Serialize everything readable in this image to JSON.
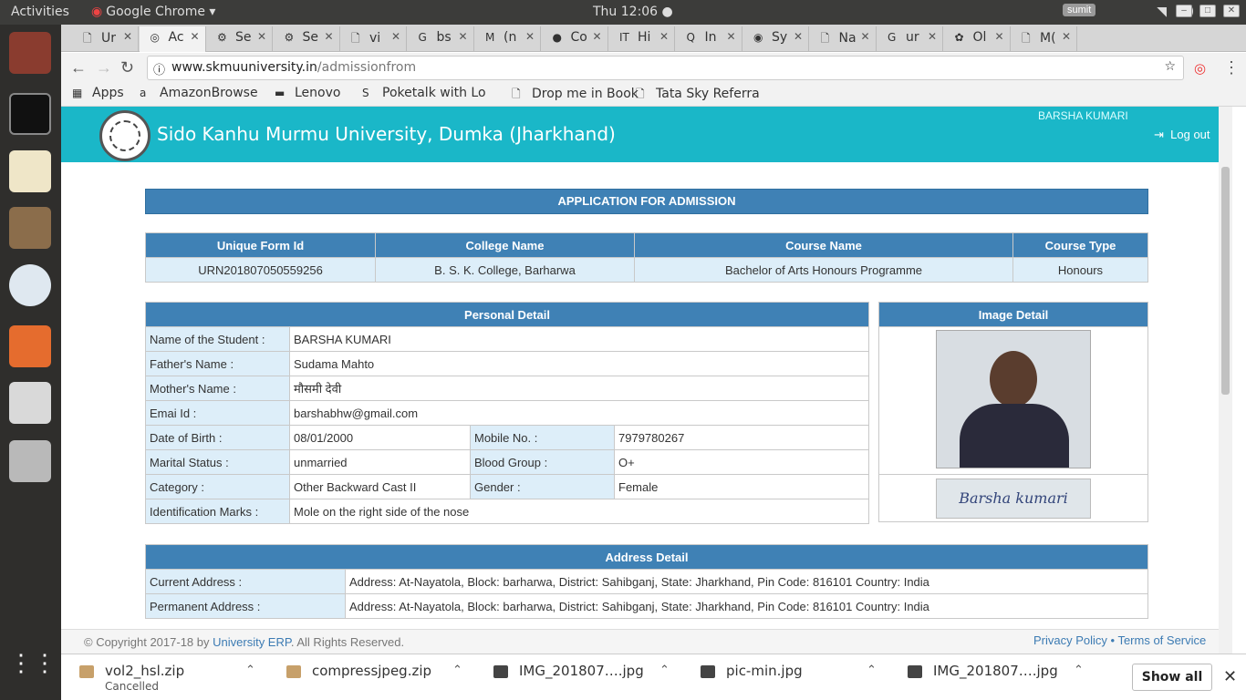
{
  "os": {
    "activities": "Activities",
    "app_menu": "Google Chrome ▾",
    "clock": "Thu 12:06 ●"
  },
  "tabs": [
    {
      "icon": "🗋",
      "label": "Ur"
    },
    {
      "icon": "◎",
      "label": "Ac",
      "active": true
    },
    {
      "icon": "⚙",
      "label": "Se"
    },
    {
      "icon": "⚙",
      "label": "Se"
    },
    {
      "icon": "🗋",
      "label": "vi"
    },
    {
      "icon": "G",
      "label": "bs"
    },
    {
      "icon": "M",
      "label": "(n"
    },
    {
      "icon": "●",
      "label": "Co"
    },
    {
      "icon": "IT",
      "label": "Hi"
    },
    {
      "icon": "Q",
      "label": "In"
    },
    {
      "icon": "◉",
      "label": "Sy"
    },
    {
      "icon": "🗋",
      "label": "Na"
    },
    {
      "icon": "G",
      "label": "ur"
    },
    {
      "icon": "✿",
      "label": "Ol"
    },
    {
      "icon": "🗋",
      "label": "M("
    }
  ],
  "tab_user": "sumit",
  "address": {
    "host": "www.skmuuniversity.in",
    "path": "/admissionfrom"
  },
  "bookmarks": [
    {
      "icon": "▦",
      "label": "Apps"
    },
    {
      "icon": "a",
      "label": "AmazonBrowse"
    },
    {
      "icon": "▬",
      "label": "Lenovo"
    },
    {
      "icon": "S",
      "label": "Poketalk with Lo"
    },
    {
      "icon": "🗋",
      "label": "Drop me in Book"
    },
    {
      "icon": "🗋",
      "label": "Tata Sky Referra"
    }
  ],
  "header": {
    "university": "Sido Kanhu Murmu University, Dumka (Jharkhand)",
    "user": "BARSHA KUMARI",
    "logout": "Log out"
  },
  "form": {
    "title": "APPLICATION FOR ADMISSION",
    "summary_headers": [
      "Unique Form Id",
      "College Name",
      "Course Name",
      "Course Type"
    ],
    "summary_values": [
      "URN201807050559256",
      "B. S. K. College, Barharwa",
      "Bachelor of Arts Honours Programme",
      "Honours"
    ],
    "personal_title": "Personal Detail",
    "image_title": "Image Detail",
    "signature_text": "Barsha kumari",
    "personal": {
      "name_l": "Name of the Student :",
      "name_v": "BARSHA KUMARI",
      "father_l": "Father's Name :",
      "father_v": "Sudama Mahto",
      "mother_l": "Mother's Name :",
      "mother_v": "मौसमी देवी",
      "email_l": "Emai Id :",
      "email_v": "barshabhw@gmail.com",
      "dob_l": "Date of Birth :",
      "dob_v": "08/01/2000",
      "mobile_l": "Mobile No. :",
      "mobile_v": "7979780267",
      "marital_l": "Marital Status :",
      "marital_v": "unmarried",
      "blood_l": "Blood Group :",
      "blood_v": "O+",
      "category_l": "Category :",
      "category_v": "Other Backward Cast II",
      "gender_l": "Gender :",
      "gender_v": "Female",
      "marks_l": "Identification Marks :",
      "marks_v": "Mole on the right side of the nose"
    },
    "address_title": "Address Detail",
    "current_l": "Current Address :",
    "current_v": "Address: At-Nayatola, Block: barharwa, District: Sahibganj, State: Jharkhand, Pin Code: 816101 Country: India",
    "permanent_l": "Permanent Address :",
    "permanent_v": "Address: At-Nayatola, Block: barharwa, District: Sahibganj, State: Jharkhand, Pin Code: 816101 Country: India"
  },
  "footer": {
    "copyright": "© Copyright 2017-18 by",
    "erp": "University ERP",
    "rights": ". All Rights Reserved.",
    "links": "Privacy Policy • Terms of Service"
  },
  "downloads": [
    {
      "name": "vol2_hsl.zip",
      "status": "Cancelled",
      "type": "zip"
    },
    {
      "name": "compressjpeg.zip",
      "status": "",
      "type": "zip"
    },
    {
      "name": "IMG_201807….jpg",
      "status": "",
      "type": "img"
    },
    {
      "name": "pic-min.jpg",
      "status": "",
      "type": "img"
    },
    {
      "name": "IMG_201807….jpg",
      "status": "",
      "type": "img"
    }
  ],
  "show_all": "Show all"
}
